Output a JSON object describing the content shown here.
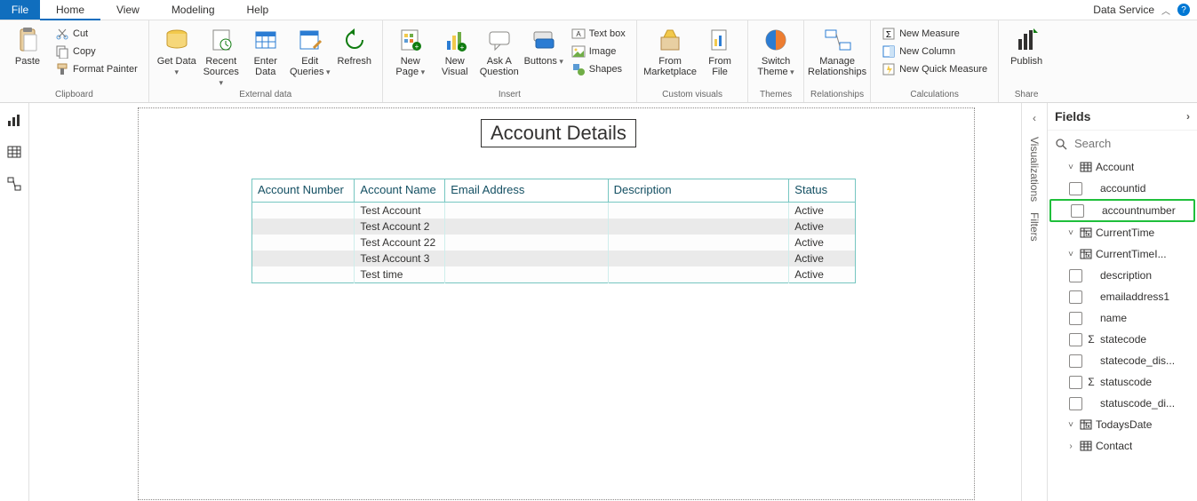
{
  "top": {
    "file": "File",
    "tabs": [
      "Home",
      "View",
      "Modeling",
      "Help"
    ],
    "active_tab_index": 0,
    "right_label": "Data Service",
    "help_badge_glyph": "?"
  },
  "ribbon": {
    "clipboard": {
      "paste": "Paste",
      "cut": "Cut",
      "copy": "Copy",
      "format_painter": "Format Painter",
      "group": "Clipboard"
    },
    "external": {
      "get_data": "Get Data",
      "recent_sources": "Recent Sources",
      "enter_data": "Enter Data",
      "edit_queries": "Edit Queries",
      "refresh": "Refresh",
      "group": "External data"
    },
    "insert": {
      "new_page": "New Page",
      "new_visual": "New Visual",
      "ask": "Ask A Question",
      "buttons": "Buttons",
      "text_box": "Text box",
      "image": "Image",
      "shapes": "Shapes",
      "group": "Insert"
    },
    "custom": {
      "from_marketplace": "From Marketplace",
      "from_file": "From File",
      "group": "Custom visuals"
    },
    "themes": {
      "switch_theme": "Switch Theme",
      "group": "Themes"
    },
    "relationships": {
      "manage": "Manage Relationships",
      "group": "Relationships"
    },
    "calculations": {
      "new_measure": "New Measure",
      "new_column": "New Column",
      "new_quick_measure": "New Quick Measure",
      "group": "Calculations"
    },
    "share": {
      "publish": "Publish",
      "group": "Share"
    }
  },
  "canvas": {
    "title": "Account Details",
    "table": {
      "headers": [
        "Account Number",
        "Account Name",
        "Email Address",
        "Description",
        "Status"
      ],
      "rows": [
        [
          "",
          "Test Account",
          "",
          "",
          "Active"
        ],
        [
          "",
          "Test Account 2",
          "",
          "",
          "Active"
        ],
        [
          "",
          "Test Account 22",
          "",
          "",
          "Active"
        ],
        [
          "",
          "Test Account 3",
          "",
          "",
          "Active"
        ],
        [
          "",
          "Test time",
          "",
          "",
          "Active"
        ]
      ]
    }
  },
  "side_rail": {
    "visualizations": "Visualizations",
    "filters": "Filters"
  },
  "fields": {
    "title": "Fields",
    "search_placeholder": "Search",
    "tree": [
      {
        "type": "table",
        "label": "Account",
        "expanded": true,
        "fields": [
          {
            "label": "accountid",
            "sigma": false
          },
          {
            "label": "accountnumber",
            "sigma": false,
            "highlight": true
          },
          {
            "type": "calc",
            "label": "CurrentTime",
            "expanded": true
          },
          {
            "type": "calc",
            "label": "CurrentTimeI...",
            "expanded": true
          },
          {
            "label": "description",
            "sigma": false
          },
          {
            "label": "emailaddress1",
            "sigma": false
          },
          {
            "label": "name",
            "sigma": false
          },
          {
            "label": "statecode",
            "sigma": true
          },
          {
            "label": "statecode_dis...",
            "sigma": false
          },
          {
            "label": "statuscode",
            "sigma": true
          },
          {
            "label": "statuscode_di...",
            "sigma": false
          },
          {
            "type": "calc",
            "label": "TodaysDate",
            "expanded": true
          }
        ]
      },
      {
        "type": "table",
        "label": "Contact",
        "expanded": false
      }
    ]
  }
}
